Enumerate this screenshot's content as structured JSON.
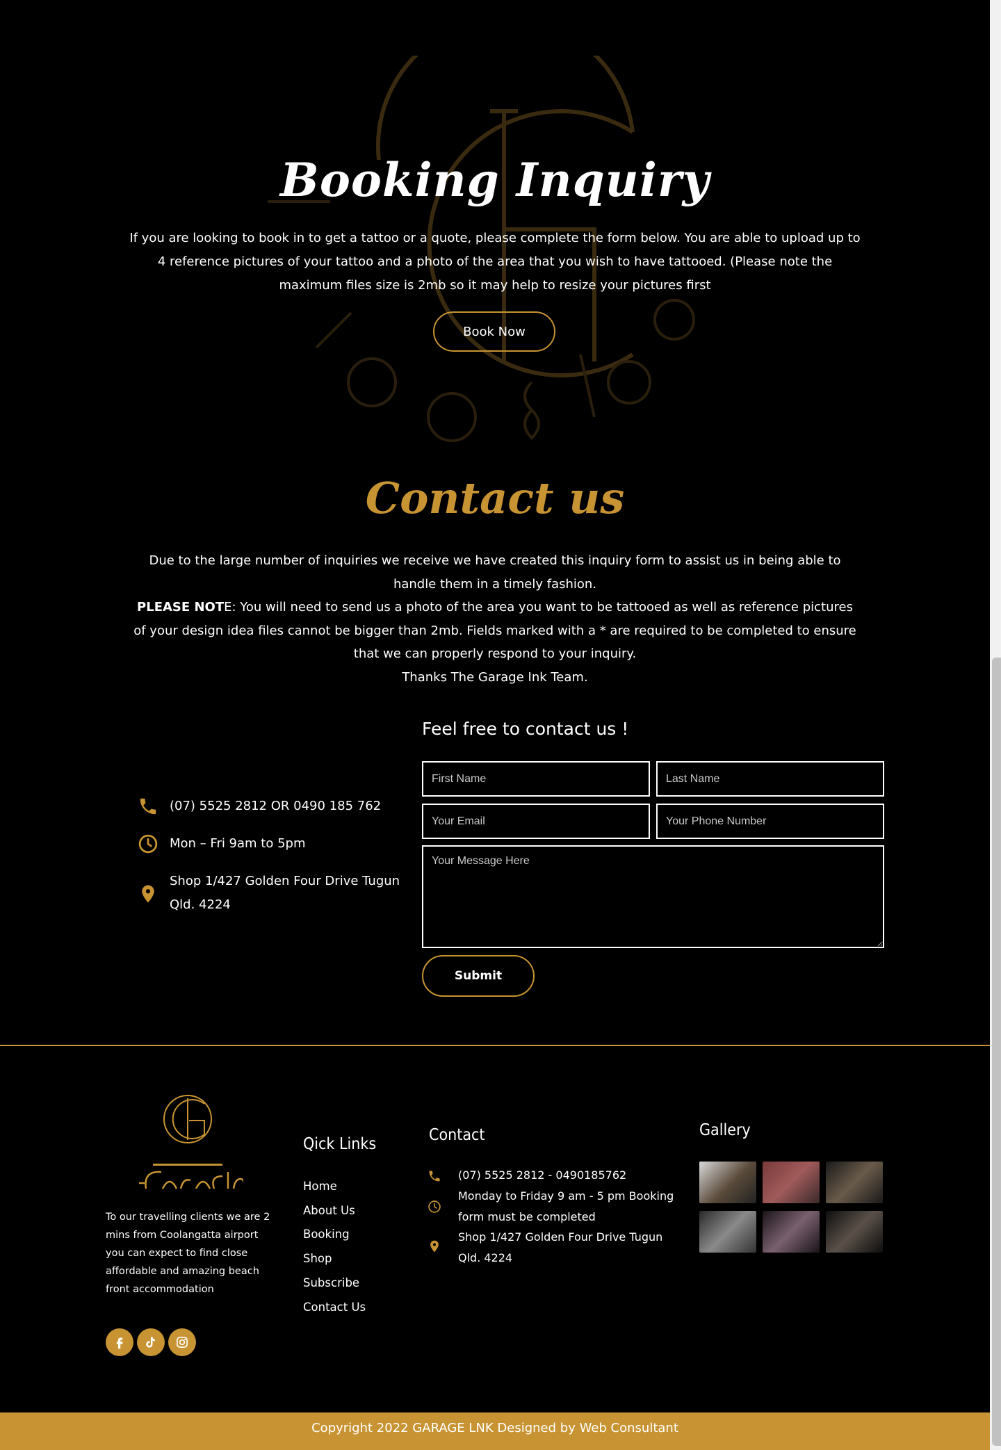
{
  "colors": {
    "accent": "#c89433",
    "background": "#000000",
    "text": "#ffffff"
  },
  "booking": {
    "title": "Booking Inquiry",
    "description": "If you are looking to book in to get a tattoo or a quote, please complete the form below. You are able to upload up to 4 reference pictures of your tattoo and a photo of the area that you wish to have tattooed. (Please note the maximum files size is 2mb so it may help to resize your pictures first",
    "button_label": "Book Now"
  },
  "contact": {
    "title": "Contact us",
    "intro": "Due to the large number of inquiries we receive we have created this inquiry form to assist us in being able to handle them in a timely fashion.",
    "note_bold": "PLEASE NOT",
    "note_rest": "E: You will need to send us a photo of the area you want to be tattooed as well as reference pictures of your design idea files cannot be bigger than 2mb. Fields marked with a * are required to be completed to ensure that we can properly respond to your inquiry.",
    "thanks": "Thanks The Garage Ink Team.",
    "info": {
      "phone": "(07) 5525 2812 OR 0490 185 762",
      "hours": "Mon – Fri 9am to 5pm",
      "address": "Shop 1/427 Golden Four Drive Tugun Qld. 4224"
    },
    "form": {
      "heading": "Feel free to contact us !",
      "first_name_placeholder": "First Name",
      "last_name_placeholder": "Last Name",
      "email_placeholder": "Your Email",
      "phone_placeholder": "Your Phone Number",
      "message_placeholder": "Your Message Here",
      "submit_label": "Submit"
    }
  },
  "footer": {
    "about": "To our travelling clients we are 2 mins from Coolangatta airport you can expect to find close affordable and amazing beach front accommodation",
    "social_icons": [
      "facebook-icon",
      "tiktok-icon",
      "instagram-icon"
    ],
    "quick_links_title": "Qick Links",
    "quick_links": [
      "Home",
      "About Us",
      "Booking",
      "Shop",
      "Subscribe",
      "Contact Us"
    ],
    "contact_title": "Contact",
    "contact_phone": "(07) 5525 2812 - 0490185762",
    "contact_hours": "Monday to Friday 9 am - 5 pm Booking form must be completed",
    "contact_address": "Shop 1/427 Golden Four Drive Tugun Qld. 4224",
    "gallery_title": "Gallery",
    "copyright": "Copyright 2022 GARAGE LNK Designed by Web Consultant"
  }
}
